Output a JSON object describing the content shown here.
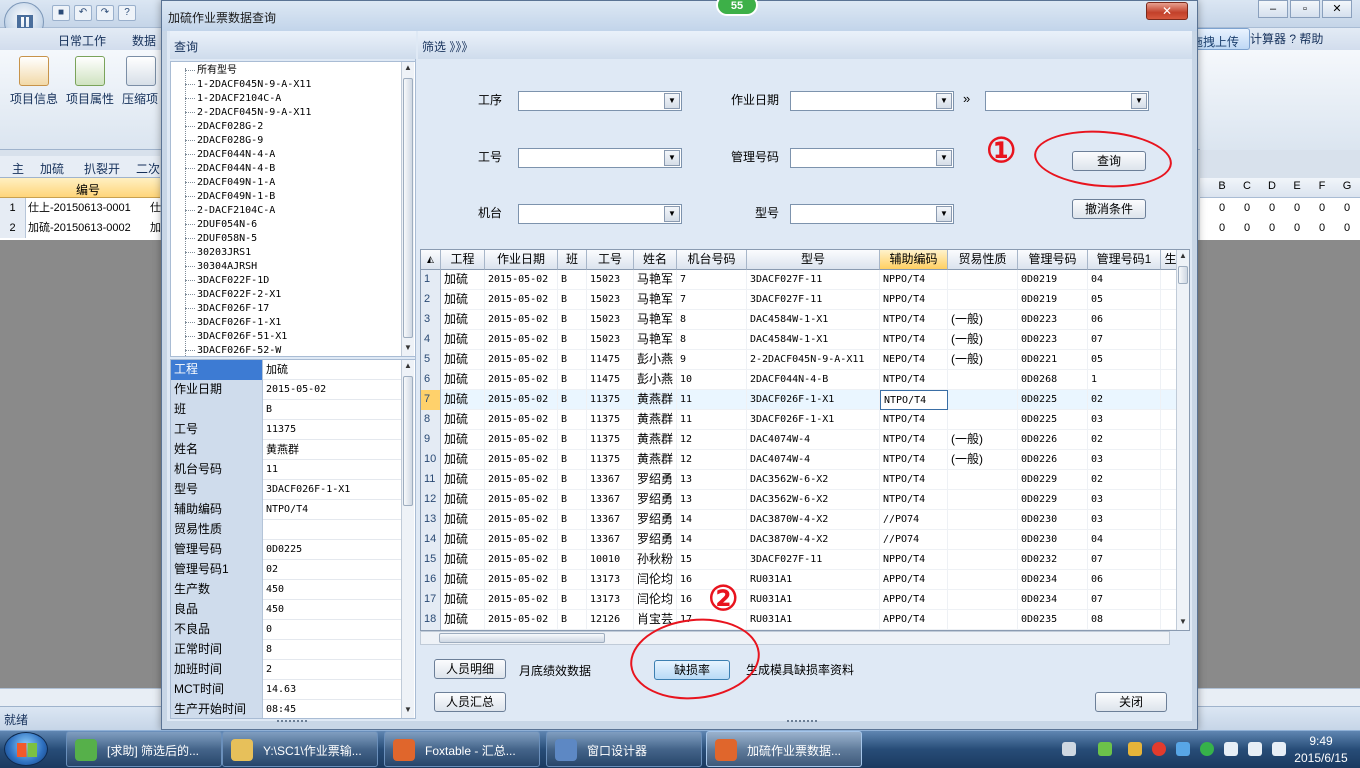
{
  "bg_app": {
    "menu": [
      "日常工作",
      "数据"
    ],
    "ribbon_buttons": [
      "项目信息",
      "项目属性",
      "压缩项"
    ],
    "tabs": [
      "主",
      "加硫",
      "扒裂开",
      "二次"
    ],
    "grid_header": "编号",
    "rows": [
      {
        "num": "1",
        "id": "仕上-20150613-0001",
        "extra": "仕"
      },
      {
        "num": "2",
        "id": "加硫-20150613-0002",
        "extra": "加"
      }
    ],
    "right_cmds": "计算器  ? 帮助",
    "upload_label": "拖拽上传",
    "col_letters": [
      "B",
      "C",
      "D",
      "E",
      "F",
      "G"
    ],
    "zero": "0",
    "status": "就绪",
    "notify_count": "55",
    "ctrl_min": "–",
    "ctrl_max": "▫",
    "ctrl_close": "✕"
  },
  "dialog": {
    "title": "加硫作业票数据查询",
    "close": "✕",
    "left_header": "查询",
    "filter_header": "筛选 》》》",
    "tree_items": [
      "所有型号",
      "1-2DACF045N-9-A-X11",
      "1-2DACF2104C-A",
      "2-2DACF045N-9-A-X11",
      "2DACF028G-2",
      "2DACF028G-9",
      "2DACF044N-4-A",
      "2DACF044N-4-B",
      "2DACF049N-1-A",
      "2DACF049N-1-B",
      "2-DACF2104C-A",
      "2DUF054N-6",
      "2DUF058N-5",
      "30203JRS1",
      "30304AJRSH",
      "3DACF022F-1D",
      "3DACF022F-2-X1",
      "3DACF026F-17",
      "3DACF026F-1-X1",
      "3DACF026F-51-X1",
      "3DACF026F-52-W"
    ],
    "props": [
      {
        "label": "工程",
        "value": "加硫"
      },
      {
        "label": "作业日期",
        "value": "2015-05-02"
      },
      {
        "label": "班",
        "value": "B"
      },
      {
        "label": "工号",
        "value": "11375"
      },
      {
        "label": "姓名",
        "value": "黄燕群"
      },
      {
        "label": "机台号码",
        "value": "11"
      },
      {
        "label": "型号",
        "value": "3DACF026F-1-X1"
      },
      {
        "label": "辅助编码",
        "value": "NTPO/T4"
      },
      {
        "label": "贸易性质",
        "value": ""
      },
      {
        "label": "管理号码",
        "value": "0D0225"
      },
      {
        "label": "管理号码1",
        "value": "02"
      },
      {
        "label": "生产数",
        "value": "450"
      },
      {
        "label": "良品",
        "value": "450"
      },
      {
        "label": "不良品",
        "value": "0"
      },
      {
        "label": "正常时间",
        "value": "8"
      },
      {
        "label": "加班时间",
        "value": "2"
      },
      {
        "label": "MCT时间",
        "value": "14.63"
      },
      {
        "label": "生产开始时间",
        "value": "08:45"
      }
    ],
    "filters": {
      "process": "工序",
      "work_date": "作业日期",
      "date_sep": "»",
      "emp_no": "工号",
      "mgmt_no": "管理号码",
      "machine": "机台",
      "model": "型号",
      "query_btn": "查询",
      "cancel_btn": "撤消条件"
    },
    "grid": {
      "headers": [
        "工程",
        "作业日期",
        "班",
        "工号",
        "姓名",
        "机台号码",
        "型号",
        "辅助编码",
        "贸易性质",
        "管理号码",
        "管理号码1",
        "生"
      ],
      "rows": [
        [
          "1",
          "加硫",
          "2015-05-02",
          "B",
          "15023",
          "马艳军",
          "7",
          "3DACF027F-11",
          "NPPO/T4",
          "",
          "0D0219",
          "04"
        ],
        [
          "2",
          "加硫",
          "2015-05-02",
          "B",
          "15023",
          "马艳军",
          "7",
          "3DACF027F-11",
          "NPPO/T4",
          "",
          "0D0219",
          "05"
        ],
        [
          "3",
          "加硫",
          "2015-05-02",
          "B",
          "15023",
          "马艳军",
          "8",
          "DAC4584W-1-X1",
          "NTPO/T4",
          "(一般)",
          "0D0223",
          "06"
        ],
        [
          "4",
          "加硫",
          "2015-05-02",
          "B",
          "15023",
          "马艳军",
          "8",
          "DAC4584W-1-X1",
          "NTPO/T4",
          "(一般)",
          "0D0223",
          "07"
        ],
        [
          "5",
          "加硫",
          "2015-05-02",
          "B",
          "11475",
          "彭小燕",
          "9",
          "2-2DACF045N-9-A-X11",
          "NEPO/T4",
          "(一般)",
          "0D0221",
          "05"
        ],
        [
          "6",
          "加硫",
          "2015-05-02",
          "B",
          "11475",
          "彭小燕",
          "10",
          "2DACF044N-4-B",
          "NTPO/T4",
          "",
          "0D0268",
          "1"
        ],
        [
          "7",
          "加硫",
          "2015-05-02",
          "B",
          "11375",
          "黄燕群",
          "11",
          "3DACF026F-1-X1",
          "NTPO/T4",
          "",
          "0D0225",
          "02"
        ],
        [
          "8",
          "加硫",
          "2015-05-02",
          "B",
          "11375",
          "黄燕群",
          "11",
          "3DACF026F-1-X1",
          "NTPO/T4",
          "",
          "0D0225",
          "03"
        ],
        [
          "9",
          "加硫",
          "2015-05-02",
          "B",
          "11375",
          "黄燕群",
          "12",
          "DAC4074W-4",
          "NTPO/T4",
          "(一般)",
          "0D0226",
          "02"
        ],
        [
          "10",
          "加硫",
          "2015-05-02",
          "B",
          "11375",
          "黄燕群",
          "12",
          "DAC4074W-4",
          "NTPO/T4",
          "(一般)",
          "0D0226",
          "03"
        ],
        [
          "11",
          "加硫",
          "2015-05-02",
          "B",
          "13367",
          "罗绍勇",
          "13",
          "DAC3562W-6-X2",
          "NTPO/T4",
          "",
          "0D0229",
          "02"
        ],
        [
          "12",
          "加硫",
          "2015-05-02",
          "B",
          "13367",
          "罗绍勇",
          "13",
          "DAC3562W-6-X2",
          "NTPO/T4",
          "",
          "0D0229",
          "03"
        ],
        [
          "13",
          "加硫",
          "2015-05-02",
          "B",
          "13367",
          "罗绍勇",
          "14",
          "DAC3870W-4-X2",
          "//PO74",
          "",
          "0D0230",
          "03"
        ],
        [
          "14",
          "加硫",
          "2015-05-02",
          "B",
          "13367",
          "罗绍勇",
          "14",
          "DAC3870W-4-X2",
          "//PO74",
          "",
          "0D0230",
          "04"
        ],
        [
          "15",
          "加硫",
          "2015-05-02",
          "B",
          "10010",
          "孙秋粉",
          "15",
          "3DACF027F-11",
          "NPPO/T4",
          "",
          "0D0232",
          "07"
        ],
        [
          "16",
          "加硫",
          "2015-05-02",
          "B",
          "13173",
          "闫伦均",
          "16",
          "RU031A1",
          "APPO/T4",
          "",
          "0D0234",
          "06"
        ],
        [
          "17",
          "加硫",
          "2015-05-02",
          "B",
          "13173",
          "闫伦均",
          "16",
          "RU031A1",
          "APPO/T4",
          "",
          "0D0234",
          "07"
        ],
        [
          "18",
          "加硫",
          "2015-05-02",
          "B",
          "12126",
          "肖宝芸",
          "17",
          "RU031A1",
          "APPO/T4",
          "",
          "0D0235",
          "08"
        ]
      ]
    },
    "bottom": {
      "staff_detail": "人员明细",
      "monthly_perf": "月底绩效数据",
      "damage_rate": "缺损率",
      "damage_note": "生成模具缺损率资料",
      "staff_summary": "人员汇总",
      "close": "关闭"
    },
    "annotations": {
      "one": "①",
      "two": "②"
    }
  },
  "taskbar": {
    "items": [
      "[求助] 筛选后的...",
      "Y:\\SC1\\作业票输...",
      "Foxtable - 汇总...",
      "窗口设计器",
      "加硫作业票数据..."
    ],
    "time": "9:49",
    "date": "2015/6/15"
  },
  "colors": {
    "accent": "#3d7bd3",
    "annotation": "#e8141e",
    "header_highlight": "#ffcf62"
  }
}
